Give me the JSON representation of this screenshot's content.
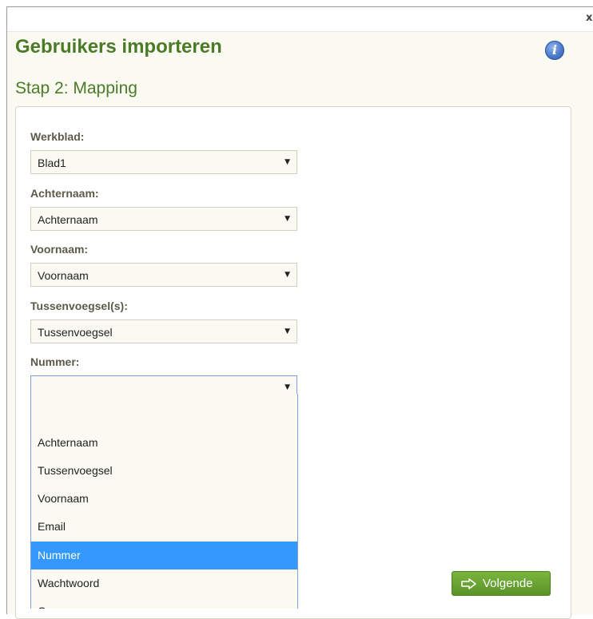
{
  "dialog": {
    "close_label": "x",
    "title": "Gebruikers importeren",
    "info_label": "i",
    "subtitle": "Stap 2: Mapping"
  },
  "form": {
    "fields": [
      {
        "label": "Werkblad:",
        "value": "Blad1"
      },
      {
        "label": "Achternaam:",
        "value": "Achternaam"
      },
      {
        "label": "Voornaam:",
        "value": "Voornaam"
      },
      {
        "label": "Tussenvoegsel(s):",
        "value": "Tussenvoegsel"
      },
      {
        "label": "Nummer:",
        "value": ""
      }
    ],
    "dropdown_arrow": "▼"
  },
  "dropdown": {
    "options": [
      "",
      "Achternaam",
      "Tussenvoegsel",
      "Voornaam",
      "Email",
      "Nummer",
      "Wachtwoord",
      "Groep"
    ],
    "selected": "Nummer"
  },
  "footer": {
    "next_label": "Volgende",
    "next_color": "#6aa534"
  },
  "colors": {
    "title": "#4b7b26",
    "highlight": "#3399ff"
  }
}
